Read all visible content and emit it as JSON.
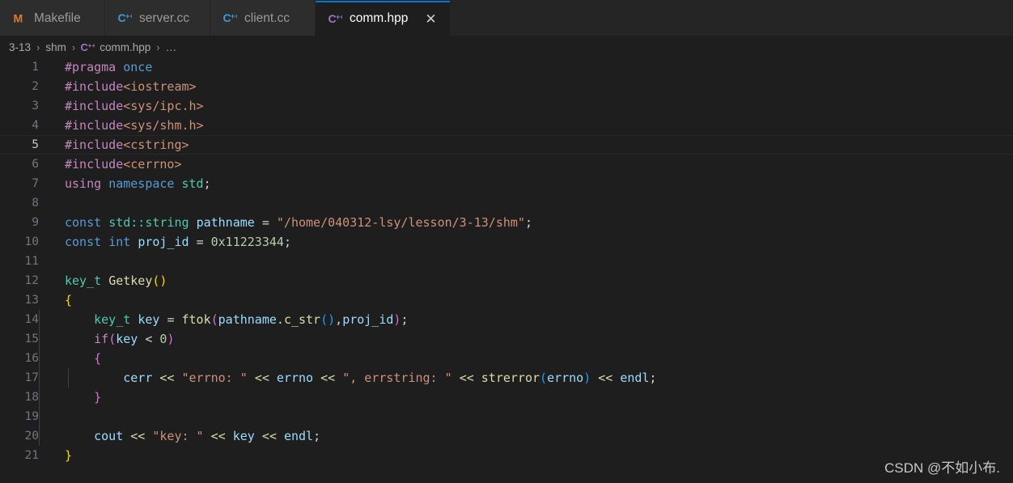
{
  "tabs": [
    {
      "label": "Makefile",
      "icon": "makefile-icon",
      "active": false,
      "closable": false
    },
    {
      "label": "server.cc",
      "icon": "cpp-source-icon",
      "active": false,
      "closable": false
    },
    {
      "label": "client.cc",
      "icon": "cpp-source-icon",
      "active": false,
      "closable": false
    },
    {
      "label": "comm.hpp",
      "icon": "cpp-header-icon",
      "active": true,
      "closable": true,
      "close_label": "✕"
    }
  ],
  "breadcrumb": {
    "items": [
      "3-13",
      "shm",
      "comm.hpp",
      "…"
    ],
    "separator": "›",
    "file_icon": "cpp-header-icon"
  },
  "editor": {
    "language": "cpp",
    "active_line": 5,
    "total_lines": 21,
    "line_numbers": [
      "1",
      "2",
      "3",
      "4",
      "5",
      "6",
      "7",
      "8",
      "9",
      "10",
      "11",
      "12",
      "13",
      "14",
      "15",
      "16",
      "17",
      "18",
      "19",
      "20",
      "21"
    ],
    "lines": [
      "#pragma once",
      "#include<iostream>",
      "#include<sys/ipc.h>",
      "#include<sys/shm.h>",
      "#include<cstring>",
      "#include<cerrno>",
      "using namespace std;",
      "",
      "const std::string pathname = \"/home/040312-lsy/lesson/3-13/shm\";",
      "const int proj_id = 0x11223344;",
      "",
      "key_t Getkey()",
      "{",
      "    key_t key = ftok(pathname.c_str(),proj_id);",
      "    if(key < 0)",
      "    {",
      "        cerr << \"errno: \" << errno << \", errstring: \" << strerror(errno) << endl;",
      "    }",
      "",
      "    cout << \"key: \" << key << endl;",
      "}"
    ]
  },
  "watermark": {
    "text": "CSDN @不如小布."
  },
  "colors": {
    "editor_background": "#1e1e1e",
    "tabbar_background": "#252526",
    "inactive_tab_background": "#2d2d2d",
    "active_tab_accent": "#0078d4",
    "line_number": "#6e7681",
    "preprocessor": "#c586c0",
    "keyword": "#569cd6",
    "string": "#ce9178",
    "type": "#4ec9b0",
    "variable": "#9cdcfe",
    "function": "#dcdcaa",
    "number": "#b5cea8"
  }
}
